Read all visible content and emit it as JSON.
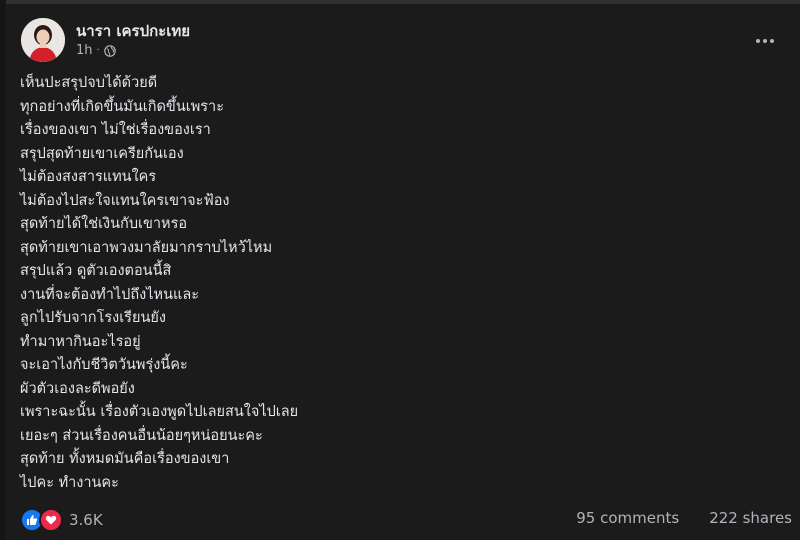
{
  "post": {
    "author": "นารา เครปกะเทย",
    "time": "1h",
    "separator": "·",
    "lines": [
      "เห็นปะสรุปจบได้ด้วยดี",
      "ทุกอย่างที่เกิดขึ้นมันเกิดขึ้นเพราะ",
      "เรื่องของเขา ไม่ใช่เรื่องของเรา",
      "สรุปสุดท้ายเขาเครียกันเอง",
      "ไม่ต้องสงสารแทนใคร",
      "ไม่ต้องไปสะใจแทนใครเขาจะฟ้อง",
      "สุดท้ายได้ใช่เงินกับเขาหรอ",
      "สุดท้ายเขาเอาพวงมาลัยมากราบไหว้ไหม",
      "สรุปแล้ว ดูตัวเองตอนนี้สิ",
      "งานที่จะต้องทำไปถึงไหนและ",
      "ลูกไปรับจากโรงเรียนยัง",
      "ทำมาหากินอะไรอยู่",
      "จะเอาไงกับชีวิตวันพรุ่งนี้คะ",
      "ผัวตัวเองละดีพอยัง",
      "เพราะฉะนั้น เรื่องตัวเองพูดไปเลยสนใจไปเลย",
      "เยอะๆ ส่วนเรื่องคนอื่นน้อยๆหน่อยนะคะ",
      "สุดท้าย ทั้งหมดมันคือเรื่องของเขา",
      "ไปคะ ทำงานคะ"
    ]
  },
  "footer": {
    "reaction_count": "3.6K",
    "comments": "95 comments",
    "shares": "222 shares"
  },
  "icons": {
    "privacy": "globe-icon",
    "menu": "more-options-icon",
    "like": "like-icon",
    "love": "love-icon"
  },
  "colors": {
    "background": "#1b1b1c",
    "text": "#e4e6eb",
    "secondary_text": "#b0b3b8",
    "like": "#1877f2",
    "love": "#f0284a"
  }
}
